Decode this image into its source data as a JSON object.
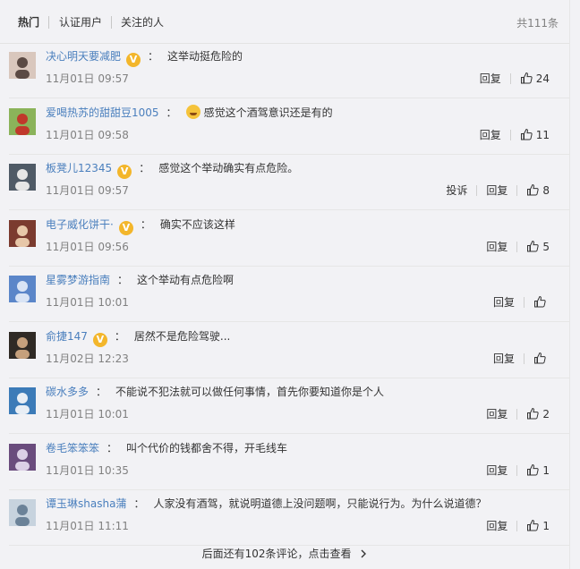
{
  "tabs": [
    {
      "label": "热门",
      "active": true
    },
    {
      "label": "认证用户",
      "active": false
    },
    {
      "label": "关注的人",
      "active": false
    }
  ],
  "total": "共111条",
  "reply_label": "回复",
  "report_label": "投诉",
  "comments": [
    {
      "user": "决心明天要减肥",
      "verified": true,
      "text": "这举动挺危险的",
      "time": "11月01日 09:57",
      "likes": "24"
    },
    {
      "user": "爱喝热苏的甜甜豆1005",
      "verified": false,
      "emoji": "laugh-cry-icon",
      "text": "感觉这个酒驾意识还是有的",
      "time": "11月01日 09:58",
      "likes": "11"
    },
    {
      "user": "板凳儿12345",
      "verified": true,
      "text": "感觉这个举动确实有点危险。",
      "time": "11月01日 09:57",
      "likes": "8",
      "report": true
    },
    {
      "user": "电子威化饼干·",
      "verified": true,
      "text": "确实不应该这样",
      "time": "11月01日 09:56",
      "likes": "5"
    },
    {
      "user": "星雾梦游指南",
      "verified": false,
      "text": "这个举动有点危险啊",
      "time": "11月01日 10:01",
      "likes": ""
    },
    {
      "user": "俞捷147",
      "verified": true,
      "text": "居然不是危险驾驶...",
      "time": "11月02日 12:23",
      "likes": ""
    },
    {
      "user": "碳水多多",
      "verified": false,
      "text": "不能说不犯法就可以做任何事情，首先你要知道你是个人",
      "time": "11月01日 10:01",
      "likes": "2"
    },
    {
      "user": "卷毛笨笨笨",
      "verified": false,
      "text": "叫个代价的钱都舍不得，开毛线车",
      "time": "11月01日 10:35",
      "likes": "1"
    },
    {
      "user": "谭玉琳shasha蒲",
      "verified": false,
      "text": "人家没有酒驾，就说明道德上没问题啊，只能说行为。为什么说道德？",
      "time": "11月01日 11:11",
      "likes": "1"
    }
  ],
  "footer": "后面还有102条评论，点击查看",
  "colors": {
    "link": "#4a7fbd",
    "badge": "#f3b62b",
    "muted": "#808080"
  }
}
